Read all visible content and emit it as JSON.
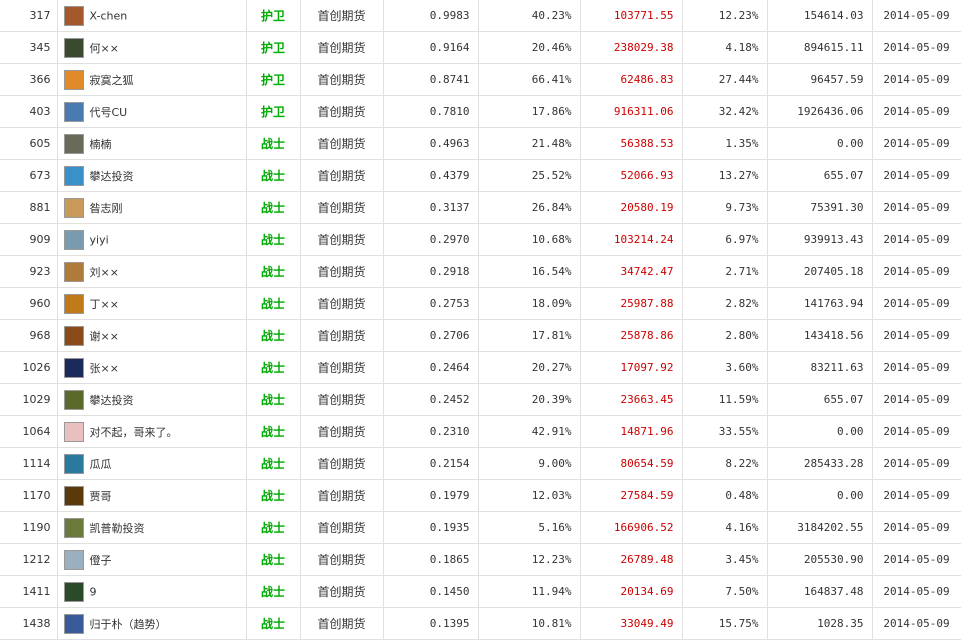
{
  "rows": [
    {
      "rank": "317",
      "name": "X-chen",
      "level": "护卫",
      "lv": "huwei",
      "company": "首创期货",
      "score": "0.9983",
      "rate": "40.23%",
      "profit": "103771.55",
      "ret": "12.23%",
      "asset": "154614.03",
      "date": "2014-05-09",
      "avatar": "#a4582c"
    },
    {
      "rank": "345",
      "name": "何××",
      "level": "护卫",
      "lv": "huwei",
      "company": "首创期货",
      "score": "0.9164",
      "rate": "20.46%",
      "profit": "238029.38",
      "ret": "4.18%",
      "asset": "894615.11",
      "date": "2014-05-09",
      "avatar": "#3a4a2e"
    },
    {
      "rank": "366",
      "name": "寂寞之狐",
      "level": "护卫",
      "lv": "huwei",
      "company": "首创期货",
      "score": "0.8741",
      "rate": "66.41%",
      "profit": "62486.83",
      "ret": "27.44%",
      "asset": "96457.59",
      "date": "2014-05-09",
      "avatar": "#e08a2a"
    },
    {
      "rank": "403",
      "name": "代号CU",
      "level": "护卫",
      "lv": "huwei",
      "company": "首创期货",
      "score": "0.7810",
      "rate": "17.86%",
      "profit": "916311.06",
      "ret": "32.42%",
      "asset": "1926436.06",
      "date": "2014-05-09",
      "avatar": "#4a7ab0"
    },
    {
      "rank": "605",
      "name": "楠楠",
      "level": "战士",
      "lv": "zhanshi",
      "company": "首创期货",
      "score": "0.4963",
      "rate": "21.48%",
      "profit": "56388.53",
      "ret": "1.35%",
      "asset": "0.00",
      "date": "2014-05-09",
      "avatar": "#6a6a5a"
    },
    {
      "rank": "673",
      "name": "攀达投资",
      "level": "战士",
      "lv": "zhanshi",
      "company": "首创期货",
      "score": "0.4379",
      "rate": "25.52%",
      "profit": "52066.93",
      "ret": "13.27%",
      "asset": "655.07",
      "date": "2014-05-09",
      "avatar": "#3a90c8"
    },
    {
      "rank": "881",
      "name": "昝志刚",
      "level": "战士",
      "lv": "zhanshi",
      "company": "首创期货",
      "score": "0.3137",
      "rate": "26.84%",
      "profit": "20580.19",
      "ret": "9.73%",
      "asset": "75391.30",
      "date": "2014-05-09",
      "avatar": "#c89a5a"
    },
    {
      "rank": "909",
      "name": "yiyi",
      "level": "战士",
      "lv": "zhanshi",
      "company": "首创期货",
      "score": "0.2970",
      "rate": "10.68%",
      "profit": "103214.24",
      "ret": "6.97%",
      "asset": "939913.43",
      "date": "2014-05-09",
      "avatar": "#7a9ab0"
    },
    {
      "rank": "923",
      "name": "刘××",
      "level": "战士",
      "lv": "zhanshi",
      "company": "首创期货",
      "score": "0.2918",
      "rate": "16.54%",
      "profit": "34742.47",
      "ret": "2.71%",
      "asset": "207405.18",
      "date": "2014-05-09",
      "avatar": "#b07a3a"
    },
    {
      "rank": "960",
      "name": "丁××",
      "level": "战士",
      "lv": "zhanshi",
      "company": "首创期货",
      "score": "0.2753",
      "rate": "18.09%",
      "profit": "25987.88",
      "ret": "2.82%",
      "asset": "141763.94",
      "date": "2014-05-09",
      "avatar": "#c07a1a"
    },
    {
      "rank": "968",
      "name": "谢××",
      "level": "战士",
      "lv": "zhanshi",
      "company": "首创期货",
      "score": "0.2706",
      "rate": "17.81%",
      "profit": "25878.86",
      "ret": "2.80%",
      "asset": "143418.56",
      "date": "2014-05-09",
      "avatar": "#8a4a1a"
    },
    {
      "rank": "1026",
      "name": "张××",
      "level": "战士",
      "lv": "zhanshi",
      "company": "首创期货",
      "score": "0.2464",
      "rate": "20.27%",
      "profit": "17097.92",
      "ret": "3.60%",
      "asset": "83211.63",
      "date": "2014-05-09",
      "avatar": "#1a2a5a"
    },
    {
      "rank": "1029",
      "name": "攀达投资",
      "level": "战士",
      "lv": "zhanshi",
      "company": "首创期货",
      "score": "0.2452",
      "rate": "20.39%",
      "profit": "23663.45",
      "ret": "11.59%",
      "asset": "655.07",
      "date": "2014-05-09",
      "avatar": "#5a6a2a"
    },
    {
      "rank": "1064",
      "name": "对不起，哥来了。",
      "level": "战士",
      "lv": "zhanshi",
      "company": "首创期货",
      "score": "0.2310",
      "rate": "42.91%",
      "profit": "14871.96",
      "ret": "33.55%",
      "asset": "0.00",
      "date": "2014-05-09",
      "avatar": "#e8c0c0"
    },
    {
      "rank": "1114",
      "name": "瓜瓜",
      "level": "战士",
      "lv": "zhanshi",
      "company": "首创期货",
      "score": "0.2154",
      "rate": "9.00%",
      "profit": "80654.59",
      "ret": "8.22%",
      "asset": "285433.28",
      "date": "2014-05-09",
      "avatar": "#2a7aa0"
    },
    {
      "rank": "1170",
      "name": "贾哥",
      "level": "战士",
      "lv": "zhanshi",
      "company": "首创期货",
      "score": "0.1979",
      "rate": "12.03%",
      "profit": "27584.59",
      "ret": "0.48%",
      "asset": "0.00",
      "date": "2014-05-09",
      "avatar": "#5a3a0a"
    },
    {
      "rank": "1190",
      "name": "凯普勒投资",
      "level": "战士",
      "lv": "zhanshi",
      "company": "首创期货",
      "score": "0.1935",
      "rate": "5.16%",
      "profit": "166906.52",
      "ret": "4.16%",
      "asset": "3184202.55",
      "date": "2014-05-09",
      "avatar": "#6a7a3a"
    },
    {
      "rank": "1212",
      "name": "僜子",
      "level": "战士",
      "lv": "zhanshi",
      "company": "首创期货",
      "score": "0.1865",
      "rate": "12.23%",
      "profit": "26789.48",
      "ret": "3.45%",
      "asset": "205530.90",
      "date": "2014-05-09",
      "avatar": "#9ab0c0"
    },
    {
      "rank": "1411",
      "name": "9",
      "level": "战士",
      "lv": "zhanshi",
      "company": "首创期货",
      "score": "0.1450",
      "rate": "11.94%",
      "profit": "20134.69",
      "ret": "7.50%",
      "asset": "164837.48",
      "date": "2014-05-09",
      "avatar": "#2a4a2a"
    },
    {
      "rank": "1438",
      "name": "归于朴（趋势）",
      "level": "战士",
      "lv": "zhanshi",
      "company": "首创期货",
      "score": "0.1395",
      "rate": "10.81%",
      "profit": "33049.49",
      "ret": "15.75%",
      "asset": "1028.35",
      "date": "2014-05-09",
      "avatar": "#3a5a9a"
    }
  ]
}
